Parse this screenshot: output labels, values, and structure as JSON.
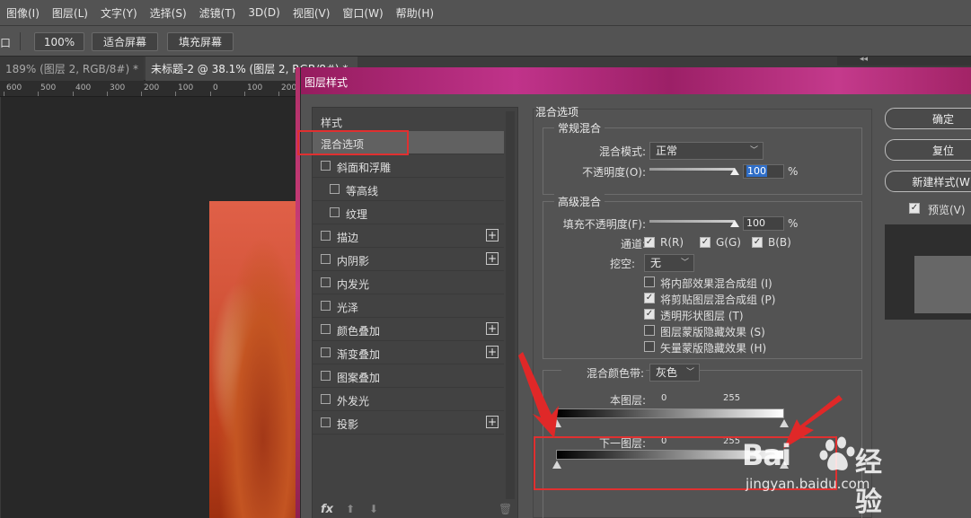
{
  "menu": [
    "图像(I)",
    "图层(L)",
    "文字(Y)",
    "选择(S)",
    "滤镜(T)",
    "3D(D)",
    "视图(V)",
    "窗口(W)",
    "帮助(H)"
  ],
  "options": {
    "edge": "口",
    "zoom": "100%",
    "fit": "适合屏幕",
    "fill": "填充屏幕"
  },
  "tabs": [
    {
      "label": "189% (图层 2, RGB/8#) *",
      "close": "✖"
    },
    {
      "label": "未标题-2 @ 38.1% (图层 2, RGB/8#) *",
      "close": ""
    }
  ],
  "panel_collapse": "◂◂",
  "ruler": [
    "600",
    "500",
    "400",
    "300",
    "200",
    "100",
    "0",
    "100",
    "200"
  ],
  "dialog": {
    "title": "图层样式",
    "left": {
      "header": "样式",
      "items": [
        {
          "label": "混合选项",
          "check": false,
          "plus": false
        },
        {
          "label": "斜面和浮雕",
          "check": true,
          "plus": false
        },
        {
          "label": "等高线",
          "check": true,
          "plus": false
        },
        {
          "label": "纹理",
          "check": true,
          "plus": false
        },
        {
          "label": "描边",
          "check": true,
          "plus": true
        },
        {
          "label": "内阴影",
          "check": true,
          "plus": true
        },
        {
          "label": "内发光",
          "check": true,
          "plus": false
        },
        {
          "label": "光泽",
          "check": true,
          "plus": false
        },
        {
          "label": "颜色叠加",
          "check": true,
          "plus": true
        },
        {
          "label": "渐变叠加",
          "check": true,
          "plus": true
        },
        {
          "label": "图案叠加",
          "check": true,
          "plus": false
        },
        {
          "label": "外发光",
          "check": true,
          "plus": false
        },
        {
          "label": "投影",
          "check": true,
          "plus": true
        }
      ],
      "footer": {
        "fx": "fx",
        "up": "⬆",
        "down": "⬇",
        "trash": "🗑"
      }
    },
    "blend_title": "混合选项",
    "general": {
      "title": "常规混合",
      "mode_label": "混合模式:",
      "mode_value": "正常",
      "opacity_label": "不透明度(O):",
      "opacity_value": "100",
      "opacity_pct": 1.0,
      "pct": "%"
    },
    "advanced": {
      "title": "高级混合",
      "fill_label": "填充不透明度(F):",
      "fill_value": "100",
      "fill_pct": 1.0,
      "pct": "%",
      "channels_label": "通道:",
      "channels": [
        "R(R)",
        "G(G)",
        "B(B)"
      ],
      "knockout_label": "挖空:",
      "knockout_value": "无",
      "options": [
        {
          "label": "将内部效果混合成组 (I)",
          "checked": false
        },
        {
          "label": "将剪贴图层混合成组 (P)",
          "checked": true
        },
        {
          "label": "透明形状图层 (T)",
          "checked": true
        },
        {
          "label": "图层蒙版隐藏效果 (S)",
          "checked": false
        },
        {
          "label": "矢量蒙版隐藏效果 (H)",
          "checked": false
        }
      ]
    },
    "blendif": {
      "label": "混合颜色带:",
      "value": "灰色",
      "this_layer": "本图层:",
      "under_layer": "下一图层:",
      "min": "0",
      "max": "255"
    },
    "buttons": {
      "ok": "确定",
      "reset": "复位",
      "new_style": "新建样式(W)",
      "preview": "预览(V)"
    }
  },
  "watermark": {
    "brand": "Bai",
    "brand_cn": "经验",
    "url": "jingyan.baidu.com"
  },
  "colors": {
    "highlight": "#e03030",
    "title_gradient": "#c0338a",
    "selection": "#2f6ec8"
  }
}
